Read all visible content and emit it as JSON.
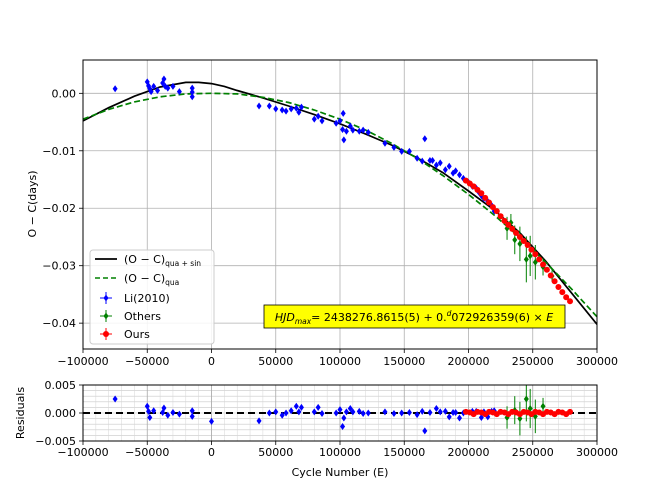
{
  "chart_data": [
    {
      "type": "scatter",
      "panel": "main",
      "xlabel": "",
      "ylabel": "O − C(days)",
      "xlim": [
        -100000,
        300000
      ],
      "ylim": [
        -0.0445,
        0.0058
      ],
      "grid": true,
      "x_ticks": [
        -100000,
        -50000,
        0,
        50000,
        100000,
        150000,
        200000,
        250000,
        300000
      ],
      "x_tick_labels": [
        "−100000",
        "−50000",
        "0",
        "50000",
        "100000",
        "150000",
        "200000",
        "250000",
        "300000"
      ],
      "y_ticks": [
        0.0,
        -0.01,
        -0.02,
        -0.03,
        -0.04
      ],
      "y_tick_labels": [
        "0.00",
        "−0.01",
        "−0.02",
        "−0.03",
        "−0.04"
      ],
      "annotation": "HJD_max = 2438276.8615(5) + 0.^d072926359(6) × E",
      "legend": {
        "placement": "lower-left",
        "entries": [
          {
            "label": "(O − C)",
            "subscript": "qua + sin",
            "style": "solid",
            "color": "#000000"
          },
          {
            "label": "(O − C)",
            "subscript": "qua",
            "style": "dashed",
            "color": "#008000"
          },
          {
            "label": "Li(2010)",
            "marker": "errorbar",
            "color": "#0000ff"
          },
          {
            "label": "Others",
            "marker": "errorbar",
            "color": "#008000"
          },
          {
            "label": "Ours",
            "marker": "errorbar",
            "color": "#ff0000"
          }
        ]
      },
      "series": [
        {
          "name": "(O − C)_qua+sin",
          "kind": "line",
          "color": "#000000",
          "x": [
            -100000,
            -80000,
            -60000,
            -40000,
            -20000,
            -10000,
            0,
            10000,
            20000,
            40000,
            60000,
            80000,
            100000,
            120000,
            140000,
            160000,
            180000,
            200000,
            220000,
            240000,
            260000,
            280000,
            300000
          ],
          "y": [
            -0.0048,
            -0.0025,
            -0.0005,
            0.0011,
            0.0019,
            0.0019,
            0.0017,
            0.0012,
            0.0005,
            -0.0008,
            -0.0022,
            -0.0037,
            -0.0053,
            -0.0071,
            -0.009,
            -0.0112,
            -0.0138,
            -0.017,
            -0.0203,
            -0.0243,
            -0.0292,
            -0.0347,
            -0.0402
          ]
        },
        {
          "name": "(O − C)_qua",
          "kind": "line",
          "color": "#008000",
          "x": [
            -100000,
            -80000,
            -60000,
            -40000,
            -20000,
            0,
            20000,
            40000,
            60000,
            80000,
            100000,
            120000,
            140000,
            160000,
            180000,
            200000,
            220000,
            240000,
            260000,
            280000,
            300000
          ],
          "y": [
            -0.0045,
            -0.0028,
            -0.0015,
            -0.0006,
            -0.0001,
            0.0,
            -0.0001,
            -0.0007,
            -0.0016,
            -0.0029,
            -0.0045,
            -0.0064,
            -0.0087,
            -0.0113,
            -0.0143,
            -0.0176,
            -0.0212,
            -0.0251,
            -0.0294,
            -0.034,
            -0.0389
          ]
        },
        {
          "name": "Li(2010)",
          "kind": "points",
          "color": "#0000ff",
          "x": [
            -75000,
            -50000,
            -49000,
            -48000,
            -47000,
            -45000,
            -42000,
            -38000,
            -37000,
            -36000,
            -34000,
            -30000,
            -25000,
            -15000,
            -15000,
            -15000,
            37000,
            45000,
            50000,
            55000,
            58000,
            62000,
            66000,
            68000,
            70000,
            80000,
            83000,
            86000,
            97000,
            100000,
            102000,
            102500,
            103000,
            105000,
            108000,
            110000,
            115000,
            118000,
            122000,
            135000,
            142000,
            148000,
            154000,
            160000,
            164000,
            166000,
            170000,
            172000,
            175000,
            178000,
            182000,
            185000,
            188000,
            190000,
            193000,
            196000,
            200000,
            203000,
            206000,
            208000,
            210000,
            212000,
            215000,
            218000,
            220000
          ],
          "y": [
            0.0008,
            0.002,
            0.0013,
            0.0008,
            0.0003,
            0.0012,
            0.0005,
            0.0018,
            0.0025,
            0.0012,
            0.0009,
            0.0012,
            0.0003,
            0.0009,
            0.0002,
            -0.0006,
            -0.0022,
            -0.0022,
            -0.0027,
            -0.0029,
            -0.0031,
            -0.0027,
            -0.0026,
            -0.0033,
            -0.0024,
            -0.0045,
            -0.004,
            -0.0048,
            -0.0052,
            -0.0048,
            -0.0063,
            -0.0035,
            -0.0081,
            -0.0066,
            -0.0057,
            -0.0064,
            -0.0066,
            -0.0064,
            -0.0068,
            -0.0087,
            -0.0094,
            -0.0101,
            -0.0101,
            -0.0113,
            -0.0118,
            -0.0079,
            -0.0117,
            -0.0117,
            -0.0125,
            -0.0121,
            -0.0133,
            -0.0127,
            -0.0139,
            -0.0135,
            -0.0142,
            -0.0148,
            -0.0155,
            -0.0162,
            -0.0165,
            -0.0172,
            -0.0178,
            -0.0183,
            -0.0188,
            -0.0195,
            -0.0205
          ],
          "err": [
            0.0002,
            0.0003,
            0.0002,
            0.0003,
            0.0002,
            0.0002,
            0.0002,
            0.0003,
            0.0004,
            0.0002,
            0.0002,
            0.0003,
            0.0002,
            0.0003,
            0.0002,
            0.0002,
            0.0002,
            0.0002,
            0.0003,
            0.0003,
            0.0002,
            0.0002,
            0.0002,
            0.0002,
            0.0002,
            0.0003,
            0.0003,
            0.0002,
            0.0003,
            0.0003,
            0.0004,
            0.0003,
            0.0003,
            0.0003,
            0.0002,
            0.0002,
            0.0002,
            0.0002,
            0.0002,
            0.0002,
            0.0002,
            0.0002,
            0.0002,
            0.0002,
            0.0003,
            0.0004,
            0.0002,
            0.0002,
            0.0002,
            0.0002,
            0.0002,
            0.0002,
            0.0003,
            0.0002,
            0.0002,
            0.0002,
            0.0002,
            0.0003,
            0.0003,
            0.0002,
            0.0003,
            0.0002,
            0.0002,
            0.0003,
            0.0002
          ]
        },
        {
          "name": "Others",
          "kind": "points",
          "color": "#008000",
          "x": [
            230000,
            233000,
            236000,
            240000,
            245000,
            248000,
            252000,
            258000,
            265000
          ],
          "y": [
            -0.0235,
            -0.0225,
            -0.0255,
            -0.0262,
            -0.0289,
            -0.0283,
            -0.0294,
            -0.0302,
            -0.0318
          ],
          "err": [
            0.002,
            0.0015,
            0.0025,
            0.003,
            0.004,
            0.0035,
            0.003,
            0.0015,
            0.001
          ]
        },
        {
          "name": "Ours",
          "kind": "points",
          "color": "#ff0000",
          "x": [
            198000,
            201000,
            204000,
            207000,
            210000,
            213000,
            216000,
            219000,
            222000,
            225000,
            228000,
            231000,
            234000,
            237000,
            240000,
            243000,
            246000,
            249000,
            252000,
            255000,
            258000,
            261000,
            264000,
            267000,
            270000,
            273000,
            276000,
            279000
          ],
          "y": [
            -0.0152,
            -0.0157,
            -0.0162,
            -0.0168,
            -0.0174,
            -0.0182,
            -0.019,
            -0.0198,
            -0.0205,
            -0.0214,
            -0.0222,
            -0.0229,
            -0.0236,
            -0.0243,
            -0.025,
            -0.0257,
            -0.0264,
            -0.0272,
            -0.028,
            -0.0289,
            -0.0298,
            -0.0307,
            -0.0317,
            -0.0327,
            -0.0337,
            -0.0346,
            -0.0355,
            -0.0362
          ],
          "err": [
            0.0002,
            0.0002,
            0.0002,
            0.0002,
            0.0002,
            0.0002,
            0.0002,
            0.0002,
            0.0002,
            0.0002,
            0.0002,
            0.0002,
            0.0002,
            0.0002,
            0.0002,
            0.0002,
            0.0002,
            0.0002,
            0.0002,
            0.0002,
            0.0002,
            0.0002,
            0.0002,
            0.0002,
            0.0002,
            0.0002,
            0.0002,
            0.0002
          ]
        }
      ]
    },
    {
      "type": "scatter",
      "panel": "residuals",
      "xlabel": "Cycle Number (E)",
      "ylabel": "Residuals",
      "xlim": [
        -100000,
        300000
      ],
      "ylim": [
        -0.005,
        0.005
      ],
      "grid": true,
      "zero_line": {
        "y": 0,
        "style": "dashed",
        "color": "#000000"
      },
      "x_ticks": [
        -100000,
        -50000,
        0,
        50000,
        100000,
        150000,
        200000,
        250000,
        300000
      ],
      "x_tick_labels": [
        "−100000",
        "−50000",
        "0",
        "50000",
        "100000",
        "150000",
        "200000",
        "250000",
        "300000"
      ],
      "y_ticks": [
        0.005,
        0.0,
        -0.005
      ],
      "y_tick_labels": [
        "0.005",
        "0.000",
        "−0.005"
      ],
      "series": [
        {
          "name": "Li(2010)",
          "kind": "points",
          "color": "#0000ff",
          "x": [
            -75000,
            -50000,
            -49000,
            -48000,
            -45000,
            -38000,
            -37000,
            -34000,
            -30000,
            -25000,
            -15000,
            -15000,
            0,
            37000,
            45000,
            50000,
            55000,
            58000,
            62000,
            66000,
            68000,
            70000,
            80000,
            83000,
            86000,
            97000,
            100000,
            102000,
            103000,
            105000,
            108000,
            110000,
            115000,
            118000,
            122000,
            135000,
            142000,
            148000,
            154000,
            160000,
            164000,
            166000,
            170000,
            175000,
            178000,
            182000,
            185000,
            188000,
            190000,
            193000,
            196000,
            203000,
            206000,
            210000,
            212000,
            215000,
            218000,
            220000
          ],
          "y": [
            0.0025,
            0.0012,
            0.0003,
            -0.0008,
            0.0004,
            0.0001,
            0.0009,
            -0.0004,
            0.0001,
            -0.0002,
            0.0004,
            -0.0006,
            -0.0015,
            -0.0014,
            0.0,
            0.0002,
            -0.0004,
            0.0,
            0.0004,
            0.0012,
            0.0002,
            0.001,
            0.0002,
            0.001,
            -0.0001,
            0.0,
            0.0006,
            -0.0024,
            -0.0009,
            0.0002,
            0.0008,
            0.0002,
            0.0003,
            -0.0001,
            0.0,
            0.0002,
            -0.0001,
            0.0,
            0.0001,
            -0.0003,
            0.0003,
            -0.0032,
            0.0001,
            0.0008,
            0.0002,
            0.0003,
            -0.0007,
            0.0001,
            0.0001,
            -0.0009,
            0.0,
            0.0003,
            0.0003,
            -0.0008,
            0.0002,
            -0.0007,
            0.0003,
            0.0004
          ],
          "err": [
            0.0003,
            0.0003,
            0.0002,
            0.0002,
            0.0002,
            0.0002,
            0.0003,
            0.0002,
            0.0003,
            0.0002,
            0.0003,
            0.0002,
            0.0002,
            0.0002,
            0.0002,
            0.0003,
            0.0003,
            0.0002,
            0.0002,
            0.0002,
            0.0002,
            0.0002,
            0.0003,
            0.0003,
            0.0002,
            0.0003,
            0.0003,
            0.0004,
            0.0003,
            0.0003,
            0.0002,
            0.0002,
            0.0002,
            0.0002,
            0.0002,
            0.0002,
            0.0002,
            0.0002,
            0.0002,
            0.0002,
            0.0003,
            0.0004,
            0.0002,
            0.0002,
            0.0002,
            0.0002,
            0.0002,
            0.0003,
            0.0002,
            0.0002,
            0.0002,
            0.0003,
            0.0003,
            0.0003,
            0.0002,
            0.0002,
            0.0003,
            0.0002
          ]
        },
        {
          "name": "Others",
          "kind": "points",
          "color": "#008000",
          "x": [
            230000,
            236000,
            240000,
            245000,
            248000,
            252000,
            258000
          ],
          "y": [
            -0.0008,
            0.0005,
            -0.001,
            0.0025,
            0.0008,
            -0.0006,
            0.0012
          ],
          "err": [
            0.002,
            0.0025,
            0.003,
            0.004,
            0.0035,
            0.003,
            0.0015
          ]
        },
        {
          "name": "Ours",
          "kind": "points",
          "color": "#ff0000",
          "x": [
            198000,
            201000,
            204000,
            207000,
            210000,
            213000,
            216000,
            219000,
            222000,
            225000,
            228000,
            231000,
            234000,
            237000,
            240000,
            243000,
            246000,
            249000,
            252000,
            255000,
            258000,
            261000,
            264000,
            267000,
            270000,
            273000,
            276000,
            279000
          ],
          "y": [
            0.0002,
            0.0001,
            -0.0002,
            0.0002,
            0.0001,
            -0.0002,
            0.0002,
            0.0001,
            -0.0002,
            0.0002,
            0.0001,
            -0.0002,
            0.0002,
            0.0001,
            -0.0002,
            0.0002,
            0.0001,
            -0.0002,
            0.0002,
            0.0001,
            -0.0002,
            0.0002,
            0.0001,
            -0.0002,
            0.0002,
            0.0001,
            -0.0002,
            0.0002
          ],
          "err": [
            0.0002,
            0.0002,
            0.0002,
            0.0002,
            0.0002,
            0.0002,
            0.0002,
            0.0002,
            0.0002,
            0.0002,
            0.0002,
            0.0002,
            0.0002,
            0.0002,
            0.0002,
            0.0002,
            0.0002,
            0.0002,
            0.0002,
            0.0002,
            0.0002,
            0.0002,
            0.0002,
            0.0002,
            0.0002,
            0.0002,
            0.0002,
            0.0002
          ]
        }
      ]
    }
  ]
}
